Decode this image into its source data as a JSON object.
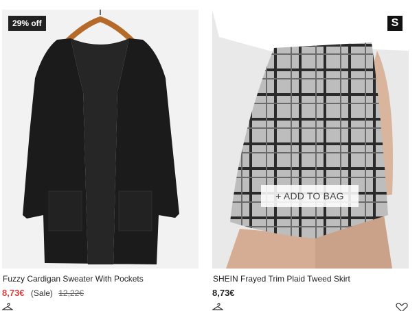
{
  "products": [
    {
      "title": "Fuzzy Cardigan Sweater With Pockets",
      "price": "8,73€",
      "sale_label": "(Sale)",
      "original_price": "12,22€",
      "badge": "29% off",
      "image_icon": "cardigan-photo",
      "price_color": "#d53f3f"
    },
    {
      "title": "SHEIN Frayed Trim Plaid Tweed Skirt",
      "price": "8,73€",
      "brand_logo": "S",
      "add_to_bag_label": "+ ADD TO BAG",
      "image_icon": "skirt-photo"
    }
  ]
}
